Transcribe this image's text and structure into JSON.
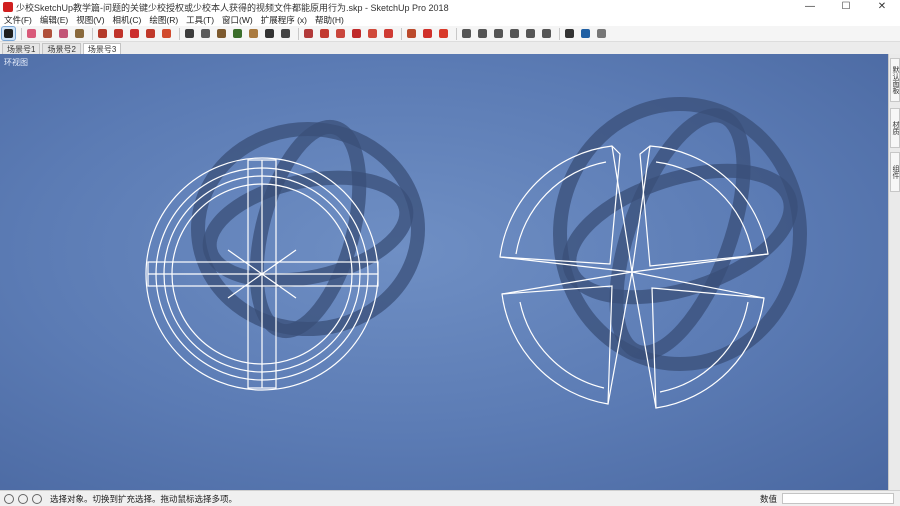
{
  "window": {
    "title": "少校SketchUp教学篇-问题的关键少校授权或少校本人获得的视频文件都能原用行为.skp - SketchUp Pro 2018",
    "minimize_icon": "minimize-icon",
    "maximize_icon": "maximize-icon",
    "close_icon": "close-icon",
    "min_glyph": "—",
    "max_glyph": "☐",
    "close_glyph": "✕"
  },
  "menu": [
    "文件(F)",
    "编辑(E)",
    "视图(V)",
    "相机(C)",
    "绘图(R)",
    "工具(T)",
    "窗口(W)",
    "扩展程序 (x)",
    "帮助(H)"
  ],
  "toolbar": {
    "tools": [
      {
        "name": "select-tool",
        "color": "#1f1f1f",
        "selected": true
      },
      {
        "name": "eraser-tool",
        "color": "#d95a7a"
      },
      {
        "name": "line-tool",
        "color": "#b0503a"
      },
      {
        "name": "arc-tool",
        "color": "#c25577"
      },
      {
        "name": "shapes-tool",
        "color": "#8a6a3d"
      },
      {
        "name": "push-pull-tool",
        "color": "#b33a2a"
      },
      {
        "name": "move-tool",
        "color": "#c0342b"
      },
      {
        "name": "rotate-tool",
        "color": "#cc2f2f"
      },
      {
        "name": "scale-tool",
        "color": "#c0392b"
      },
      {
        "name": "offset-tool",
        "color": "#d14b2e"
      },
      {
        "name": "tape-measure-tool",
        "color": "#3d3d3d"
      },
      {
        "name": "text-tool",
        "color": "#5b5b5b"
      },
      {
        "name": "paint-bucket-tool",
        "color": "#7d5a2f"
      },
      {
        "name": "orbit-tool",
        "color": "#3b6e2b"
      },
      {
        "name": "pan-tool",
        "color": "#a97a3f"
      },
      {
        "name": "zoom-tool",
        "color": "#333333"
      },
      {
        "name": "zoom-extents-tool",
        "color": "#444444"
      },
      {
        "name": "warehouse-tool",
        "color": "#b23a3a"
      },
      {
        "name": "extension-warehouse-tool",
        "color": "#c23a30"
      },
      {
        "name": "layout-tool",
        "color": "#c9463c"
      },
      {
        "name": "ruby-tool",
        "color": "#c02a2a"
      },
      {
        "name": "sandbox-tool",
        "color": "#d04a3a"
      },
      {
        "name": "solid-tools",
        "color": "#cf3b34"
      },
      {
        "name": "xray-style",
        "color": "#bb4a2c"
      },
      {
        "name": "backedges-style",
        "color": "#d0302a"
      },
      {
        "name": "shaded-style",
        "color": "#d93a2a"
      },
      {
        "name": "iso-view",
        "color": "#555555"
      },
      {
        "name": "top-view",
        "color": "#555555"
      },
      {
        "name": "front-view",
        "color": "#555555"
      },
      {
        "name": "right-view",
        "color": "#555555"
      },
      {
        "name": "back-view",
        "color": "#555555"
      },
      {
        "name": "left-view",
        "color": "#555555"
      },
      {
        "name": "section-plane-tool",
        "color": "#333333"
      },
      {
        "name": "outliner-tool",
        "color": "#1f5fa3"
      },
      {
        "name": "settings-tool",
        "color": "#777777"
      }
    ]
  },
  "scenes": [
    "场景号1",
    "场景号2",
    "场景号3"
  ],
  "active_scene": 2,
  "viewport": {
    "view_label": "环视图",
    "background_color": "#5b7bb4"
  },
  "trays": [
    "默认面板",
    "材质",
    "组件"
  ],
  "status": {
    "icons": [
      "geo-location-icon",
      "credit-icon",
      "user-icon"
    ],
    "message": "选择对象。切换到扩充选择。拖动鼠标选择多项。",
    "measurements_label": "数值"
  }
}
